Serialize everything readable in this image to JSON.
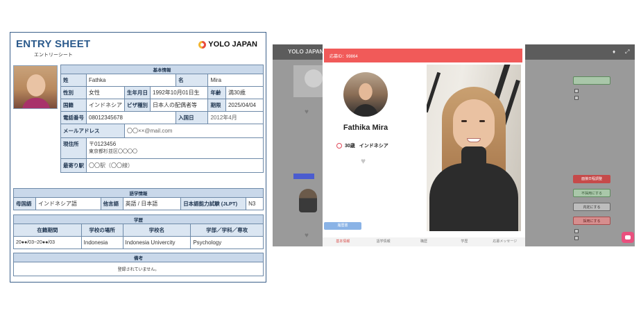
{
  "entry_sheet": {
    "title": "ENTRY SHEET",
    "subtitle": "エントリーシート",
    "logo_text": "YOLO JAPAN",
    "basic": {
      "header": "基本情報",
      "last_name_label": "姓",
      "last_name": "Fathka",
      "first_name_label": "名",
      "first_name": "Mira",
      "gender_label": "性別",
      "gender": "女性",
      "birth_label": "生年月日",
      "birth": "1992年10月01日生",
      "age_label": "年齢",
      "age": "満30歳",
      "nationality_label": "国籍",
      "nationality": "インドネシア",
      "visa_label": "ビザ種別",
      "visa": "日本人の配偶者等",
      "expiry_label": "期限",
      "expiry": "2025/04/04",
      "phone_label": "電話番号",
      "phone": "08012345678",
      "entry_label": "入国日",
      "entry": "2012年4月",
      "email_label": "メールアドレス",
      "email": "〇〇××@mail.com",
      "address_label": "現住所",
      "postal": "〒0123456",
      "address": "東京都杉並区〇〇〇〇",
      "station_label": "最寄り駅",
      "station": "〇〇駅（〇〇線）"
    },
    "language": {
      "header": "語学情報",
      "native_label": "母国語",
      "native": "インドネシア語",
      "other_label": "他言語",
      "other": "英語 / 日本語",
      "jlpt_label": "日本語能力試験 (JLPT)",
      "jlpt": "N3"
    },
    "education": {
      "header": "学歴",
      "col_period": "在籍期間",
      "col_location": "学校の場所",
      "col_school": "学校名",
      "col_major": "学部／学科／専攻",
      "period": "20●●/03~20●●/03",
      "location": "Indonesia",
      "school": "Indonesia Univercity",
      "major": "Psychology"
    },
    "remarks": {
      "header": "備考",
      "text": "登録されていません。"
    }
  },
  "yolo_screen": {
    "brand": "YOLO JAPAN",
    "modal_header": "応募ID：99864",
    "name": "Fathika Mira",
    "age": "30歳",
    "nationality": "インドネシア",
    "detail_button": "履歴書",
    "tabs": [
      "基本情報",
      "語学情報",
      "職歴",
      "学歴",
      "応募メッセージ"
    ],
    "right_buttons": [
      "面接日程調整",
      "不採用にする",
      "内定にする",
      "採用にする"
    ],
    "colors": {
      "header": "#f15a59",
      "tab_active": "#d9534f",
      "chat": "#e9507e"
    }
  }
}
